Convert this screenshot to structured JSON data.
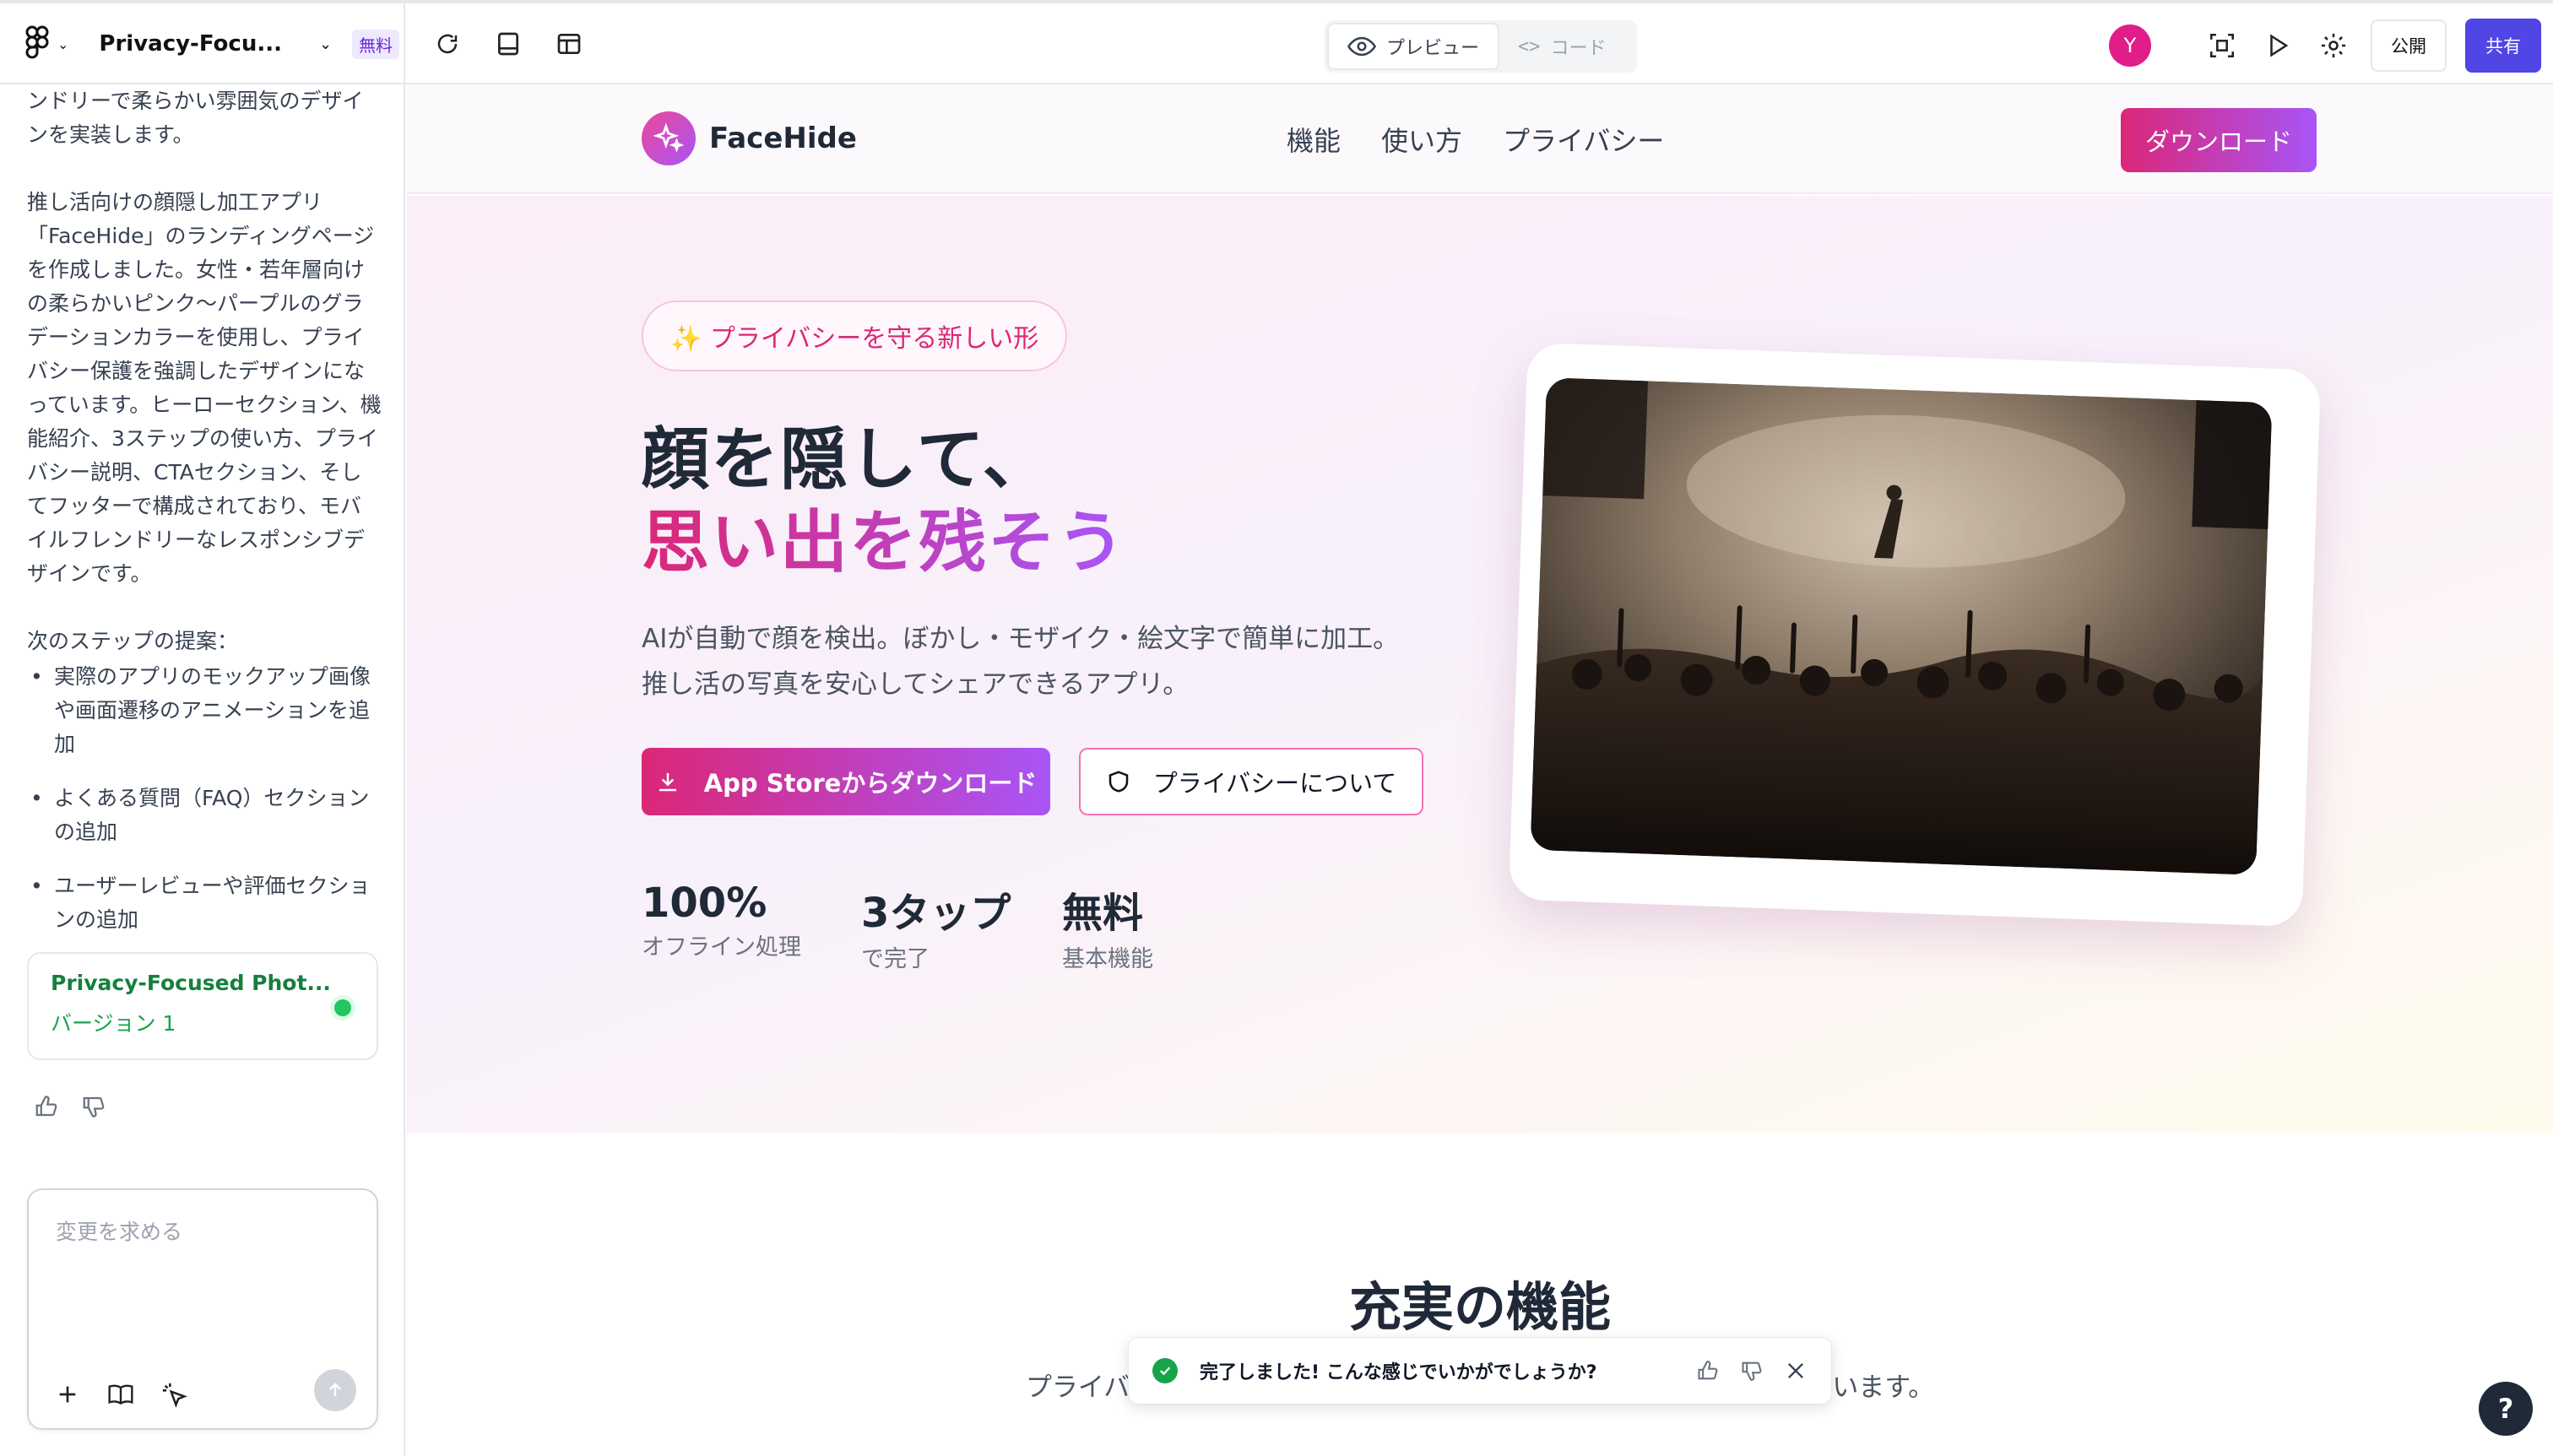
{
  "app": {
    "project_title": "Privacy-Focu...",
    "plan_badge": "無料",
    "view_tabs": {
      "preview": "プレビュー",
      "code": "コード"
    },
    "user_initial": "Y",
    "publish_label": "公開",
    "share_label": "共有"
  },
  "chat": {
    "intro_tail": "ンドリーで柔らかい雰囲気のデザインを実装します。",
    "summary": "推し活向けの顔隠し加工アプリ「FaceHide」のランディングページを作成しました。女性・若年層向けの柔らかいピンク〜パープルのグラデーションカラーを使用し、プライバシー保護を強調したデザインになっています。ヒーローセクション、機能紹介、3ステップの使い方、プライバシー説明、CTAセクション、そしてフッターで構成されており、モバイルフレンドリーなレスポンシブデザインです。",
    "next_steps_title": "次のステップの提案：",
    "next_steps": [
      "実際のアプリのモックアップ画像や画面遷移のアニメーションを追加",
      "よくある質問（FAQ）セクションの追加",
      "ユーザーレビューや評価セクションの追加"
    ],
    "version_card": {
      "title": "Privacy-Focused Phot...",
      "version": "バージョン 1"
    },
    "composer_placeholder": "変更を求める"
  },
  "landing": {
    "brand": "FaceHide",
    "nav": [
      "機能",
      "使い方",
      "プライバシー"
    ],
    "nav_download": "ダウンロード",
    "pill": "✨ プライバシーを守る新しい形",
    "headline_1": "顔を隠して、",
    "headline_2": "思い出を残そう",
    "lead_1": "AIが自動で顔を検出。ぼかし・モザイク・絵文字で簡単に加工。",
    "lead_2": "推し活の写真を安心してシェアできるアプリ。",
    "cta_primary": "App Storeからダウンロード",
    "cta_secondary": "プライバシーについて",
    "stats": [
      {
        "value": "100%",
        "label": "オフライン処理"
      },
      {
        "value": "3タップ",
        "label": "で完了"
      },
      {
        "value": "無料",
        "label": "基本機能"
      }
    ],
    "features_title": "充実の機能",
    "features_desc": "プライバシーを守りながら推し活を楽しむための機能がすべて揃っています。"
  },
  "toast": {
    "message": "完了しました! こんな感じでいかがでしょうか?"
  },
  "help_label": "?",
  "colors": {
    "accent": "#4f46e5",
    "brand_pink": "#db2777",
    "brand_purple": "#a855f7",
    "success": "#16a34a"
  }
}
